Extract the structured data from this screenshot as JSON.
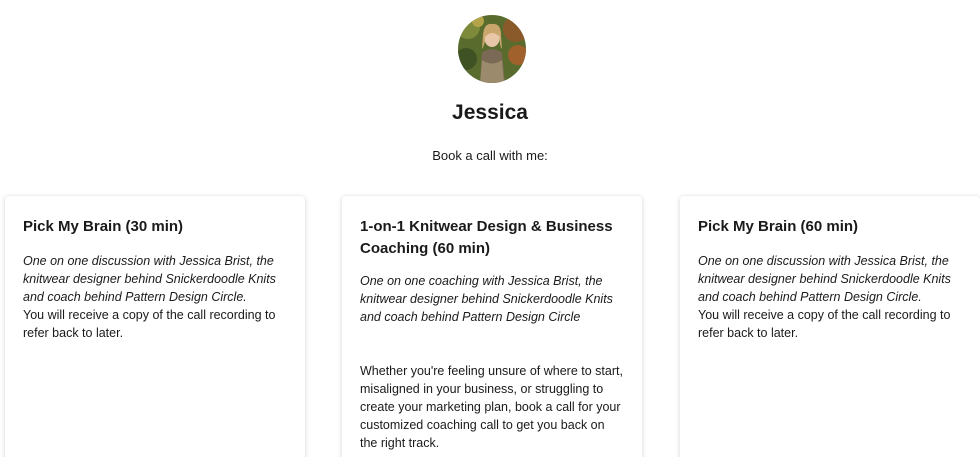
{
  "profile": {
    "name": "Jessica",
    "subtitle": "Book a call with me:"
  },
  "cards": [
    {
      "title": "Pick My Brain (30 min)",
      "description": "One on one discussion with Jessica Brist, the knitwear designer behind Snickerdoodle Knits and coach behind Pattern Design Circle.",
      "extra": "You will receive a copy of the call recording to refer back to later."
    },
    {
      "title": "1-on-1 Knitwear Design & Business Coaching (60 min)",
      "description": "One on one coaching with Jessica Brist, the knitwear designer behind Snickerdoodle Knits and coach behind Pattern Design Circle",
      "extra": "Whether you're feeling unsure of where to start, misaligned in your business, or struggling to create your marketing plan, book a call for your customized coaching call to get you back on the right track."
    },
    {
      "title": "Pick My Brain (60 min)",
      "description": "One on one discussion with Jessica Brist, the knitwear designer behind Snickerdoodle Knits and coach behind Pattern Design Circle.",
      "extra": "You will receive a copy of the call recording to refer back to later."
    }
  ]
}
